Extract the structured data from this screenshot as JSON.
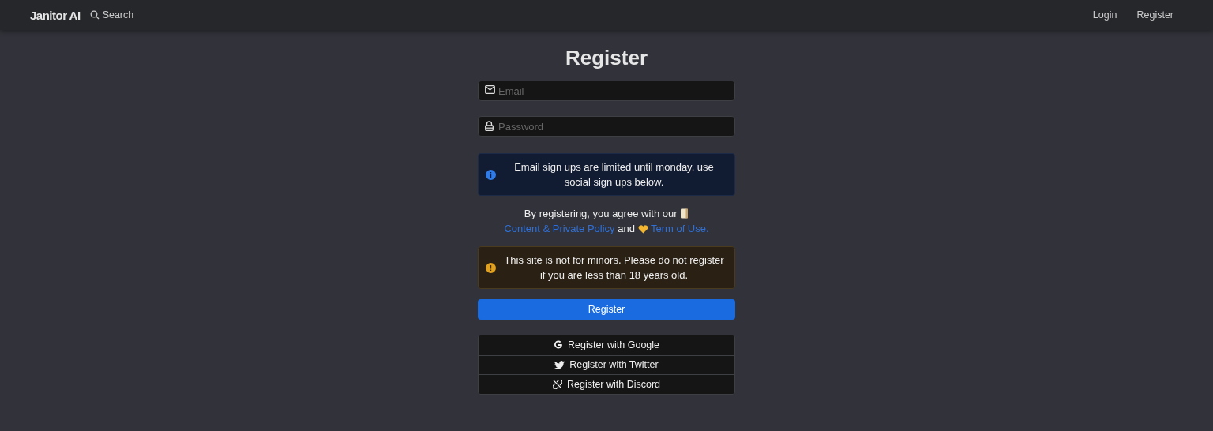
{
  "navbar": {
    "brand": "Janitor AI",
    "search": "Search",
    "links": [
      "Login",
      "Register"
    ]
  },
  "heading": "Register",
  "fields": [
    {
      "kind": "email",
      "placeholder": "Email"
    },
    {
      "kind": "password",
      "placeholder": "Password"
    }
  ],
  "notice": {
    "kind": "info",
    "text": "Email sign ups are limited until monday, use social sign ups below."
  },
  "agreement": {
    "prefix": "By registering, you agree with our",
    "link_1": "Content & Private Policy",
    "middle": "and",
    "link_2": "Term of Use."
  },
  "warning": {
    "kind": "warning",
    "text": "This site is not for minors. Please do not register if you are less than 18 years old."
  },
  "submit": "Register",
  "social": [
    {
      "kind": "google",
      "label": "Register with Google"
    },
    {
      "kind": "twitter",
      "label": "Register with Twitter"
    },
    {
      "kind": "discord",
      "label": "Register with Discord"
    }
  ]
}
